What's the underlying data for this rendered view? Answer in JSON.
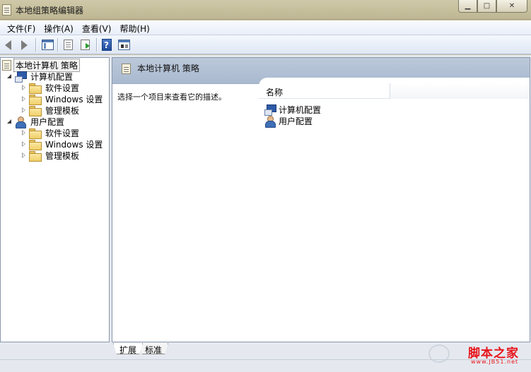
{
  "window": {
    "title": "本地组策略编辑器"
  },
  "menu": [
    "文件(F)",
    "操作(A)",
    "查看(V)",
    "帮助(H)"
  ],
  "toolbar": {
    "help_label": "?"
  },
  "tree": {
    "root": "本地计算机 策略",
    "computer": "计算机配置",
    "computer_children": [
      "软件设置",
      "Windows 设置",
      "管理模板"
    ],
    "user": "用户配置",
    "user_children": [
      "软件设置",
      "Windows 设置",
      "管理模板"
    ]
  },
  "details": {
    "header_title": "本地计算机 策略",
    "description": "选择一个项目来查看它的描述。",
    "column_name": "名称",
    "items": [
      "计算机配置",
      "用户配置"
    ]
  },
  "tabs": [
    "扩展",
    "标准"
  ],
  "watermark": {
    "main": "脚本之家",
    "url": "www.JB51.net"
  }
}
